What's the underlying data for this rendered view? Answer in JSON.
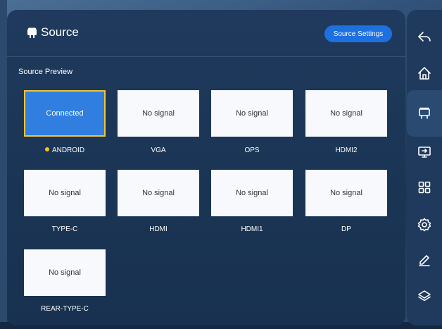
{
  "header": {
    "title": "Source",
    "settings_button": "Source Settings"
  },
  "preview": {
    "section_title": "Source Preview",
    "sources": [
      {
        "status": "Connected",
        "label": "ANDROID",
        "active": true
      },
      {
        "status": "No signal",
        "label": "VGA"
      },
      {
        "status": "No signal",
        "label": "OPS"
      },
      {
        "status": "No signal",
        "label": "HDMI2"
      },
      {
        "status": "No signal",
        "label": "TYPE-C"
      },
      {
        "status": "No signal",
        "label": "HDMI"
      },
      {
        "status": "No signal",
        "label": "HDMI1"
      },
      {
        "status": "No signal",
        "label": "DP"
      },
      {
        "status": "No signal",
        "label": "REAR-TYPE-C"
      }
    ]
  },
  "sidebar": {
    "items": [
      "back-icon",
      "home-icon",
      "source-icon",
      "screen-mirror-icon",
      "apps-grid-icon",
      "settings-gear-icon",
      "pen-icon",
      "layers-icon"
    ],
    "active": "source-icon"
  },
  "colors": {
    "accent": "#1e6fe0",
    "connected_tile": "#2f7ee0",
    "active_border": "#f0c43b",
    "status_dot": "#f3c41c"
  }
}
